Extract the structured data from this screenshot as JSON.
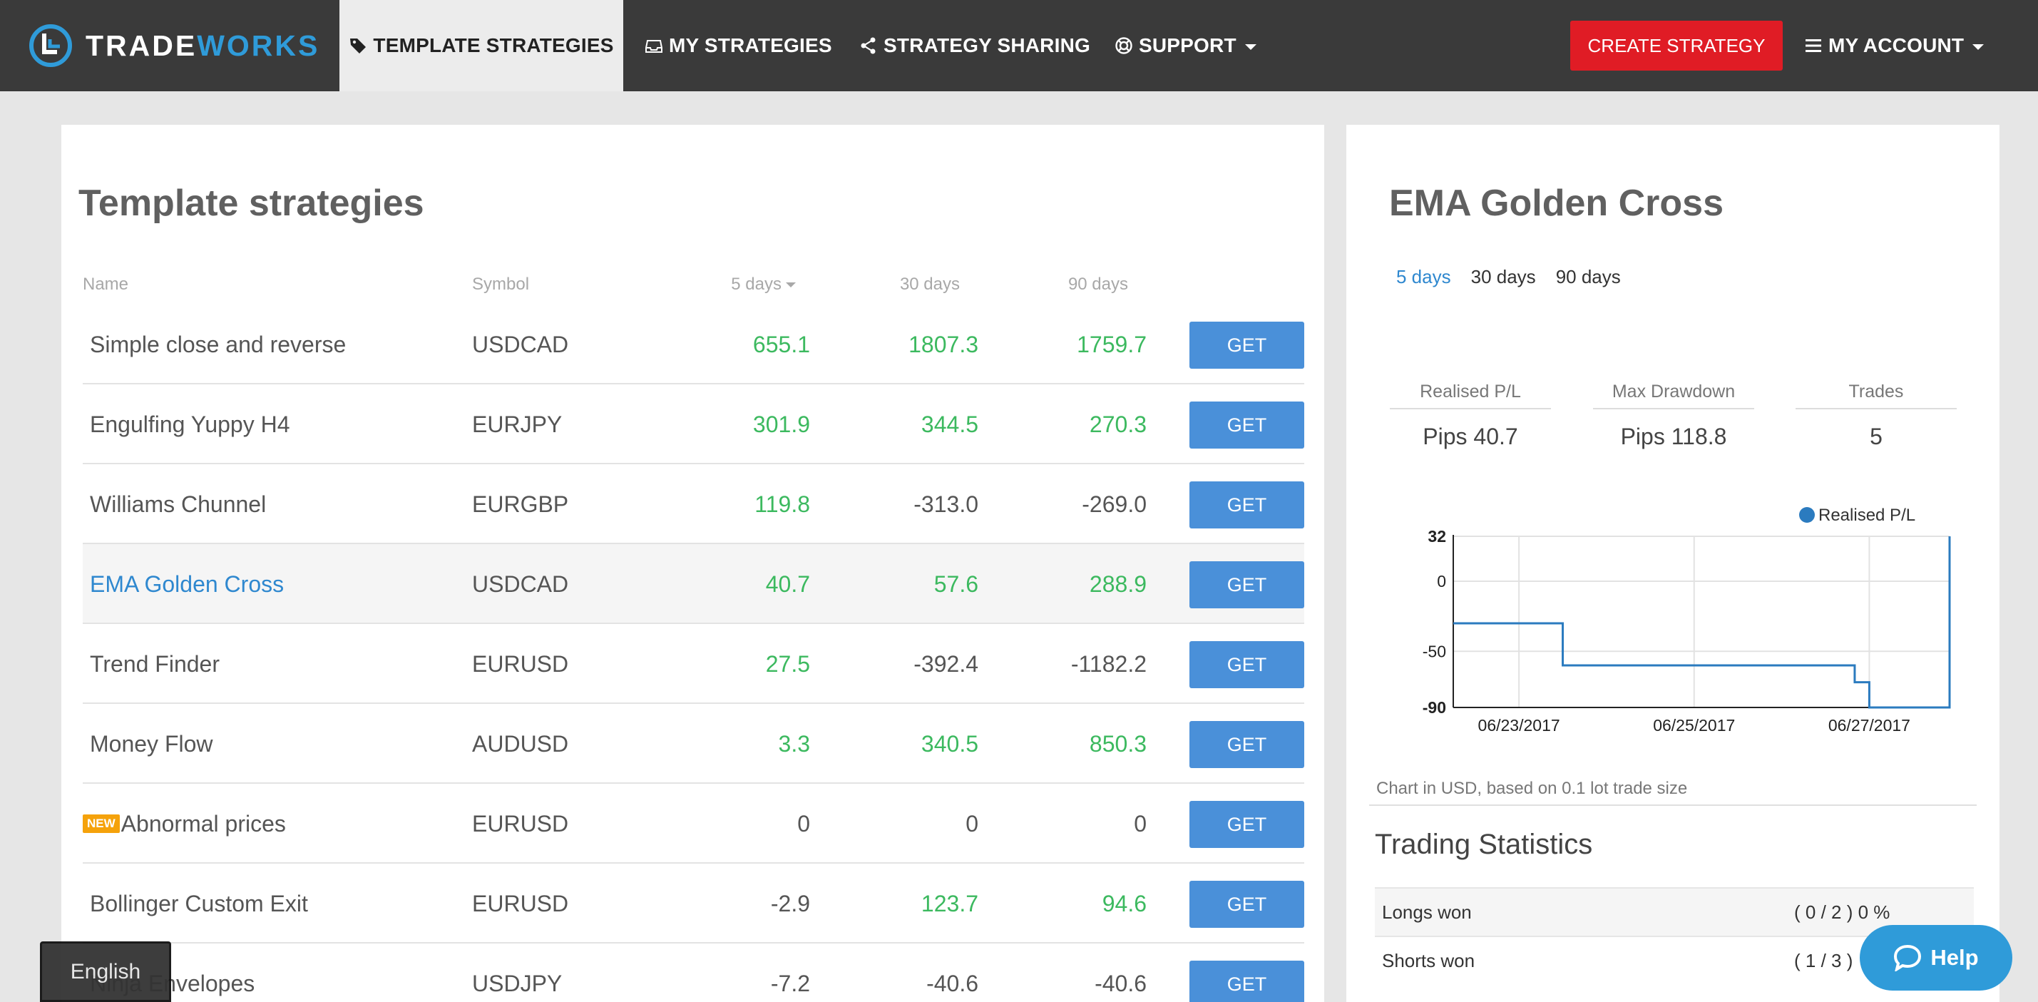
{
  "brand": {
    "trade": "TRADE",
    "works": "WORKS"
  },
  "nav": {
    "template_strategies": "TEMPLATE STRATEGIES",
    "my_strategies": "MY STRATEGIES",
    "strategy_sharing": "STRATEGY SHARING",
    "support": "SUPPORT",
    "create_strategy": "CREATE STRATEGY",
    "my_account": "MY ACCOUNT"
  },
  "left": {
    "title": "Template strategies",
    "columns": {
      "name": "Name",
      "symbol": "Symbol",
      "d5": "5 days",
      "d30": "30 days",
      "d90": "90 days"
    },
    "get_label": "GET",
    "new_badge": "NEW",
    "rows": [
      {
        "name": "Simple close and reverse",
        "symbol": "USDCAD",
        "d5": "655.1",
        "d30": "1807.3",
        "d90": "1759.7"
      },
      {
        "name": "Engulfing Yuppy H4",
        "symbol": "EURJPY",
        "d5": "301.9",
        "d30": "344.5",
        "d90": "270.3"
      },
      {
        "name": "Williams Chunnel",
        "symbol": "EURGBP",
        "d5": "119.8",
        "d30": "-313.0",
        "d90": "-269.0"
      },
      {
        "name": "EMA Golden Cross",
        "symbol": "USDCAD",
        "d5": "40.7",
        "d30": "57.6",
        "d90": "288.9"
      },
      {
        "name": "Trend Finder",
        "symbol": "EURUSD",
        "d5": "27.5",
        "d30": "-392.4",
        "d90": "-1182.2"
      },
      {
        "name": "Money Flow",
        "symbol": "AUDUSD",
        "d5": "3.3",
        "d30": "340.5",
        "d90": "850.3"
      },
      {
        "name": "Abnormal prices",
        "symbol": "EURUSD",
        "d5": "0",
        "d30": "0",
        "d90": "0"
      },
      {
        "name": "Bollinger Custom Exit",
        "symbol": "EURUSD",
        "d5": "-2.9",
        "d30": "123.7",
        "d90": "94.6"
      },
      {
        "name": "Ninja Envelopes",
        "symbol": "USDJPY",
        "d5": "-7.2",
        "d30": "-40.6",
        "d90": "-40.6"
      }
    ]
  },
  "right": {
    "title": "EMA Golden Cross",
    "periods": [
      "5 days",
      "30 days",
      "90 days"
    ],
    "stats": [
      {
        "label": "Realised P/L",
        "value": "Pips 40.7"
      },
      {
        "label": "Max Drawdown",
        "value": "Pips 118.8"
      },
      {
        "label": "Trades",
        "value": "5"
      }
    ],
    "chart_note": "Chart in USD, based on 0.1 lot trade size",
    "trading_stats_title": "Trading Statistics",
    "trading_stats": [
      {
        "label": "Longs won",
        "value": "( 0 / 2 ) 0 %"
      },
      {
        "label": "Shorts won",
        "value": "( 1 / 3 )"
      }
    ]
  },
  "chart_data": {
    "type": "line",
    "legend": "Realised P/L",
    "legend_position": "top-right",
    "y_ticks": [
      "32",
      "0",
      "-50",
      "-90"
    ],
    "ylim": [
      -90,
      32
    ],
    "x_ticks": [
      "06/23/2017",
      "06/25/2017",
      "06/27/2017"
    ],
    "grid": true,
    "series": [
      {
        "name": "Realised P/L",
        "points": [
          [
            "06/22/2017 06:00",
            -30
          ],
          [
            "06/23/2017 12:00",
            -30
          ],
          [
            "06/23/2017 12:00",
            -60
          ],
          [
            "06/26/2017 20:00",
            -60
          ],
          [
            "06/26/2017 20:00",
            -72
          ],
          [
            "06/27/2017 00:00",
            -72
          ],
          [
            "06/27/2017 00:00",
            -90
          ],
          [
            "06/27/2017 22:00",
            -90
          ],
          [
            "06/27/2017 22:00",
            32
          ]
        ]
      }
    ]
  },
  "footer": {
    "language": "English",
    "help": "Help"
  }
}
